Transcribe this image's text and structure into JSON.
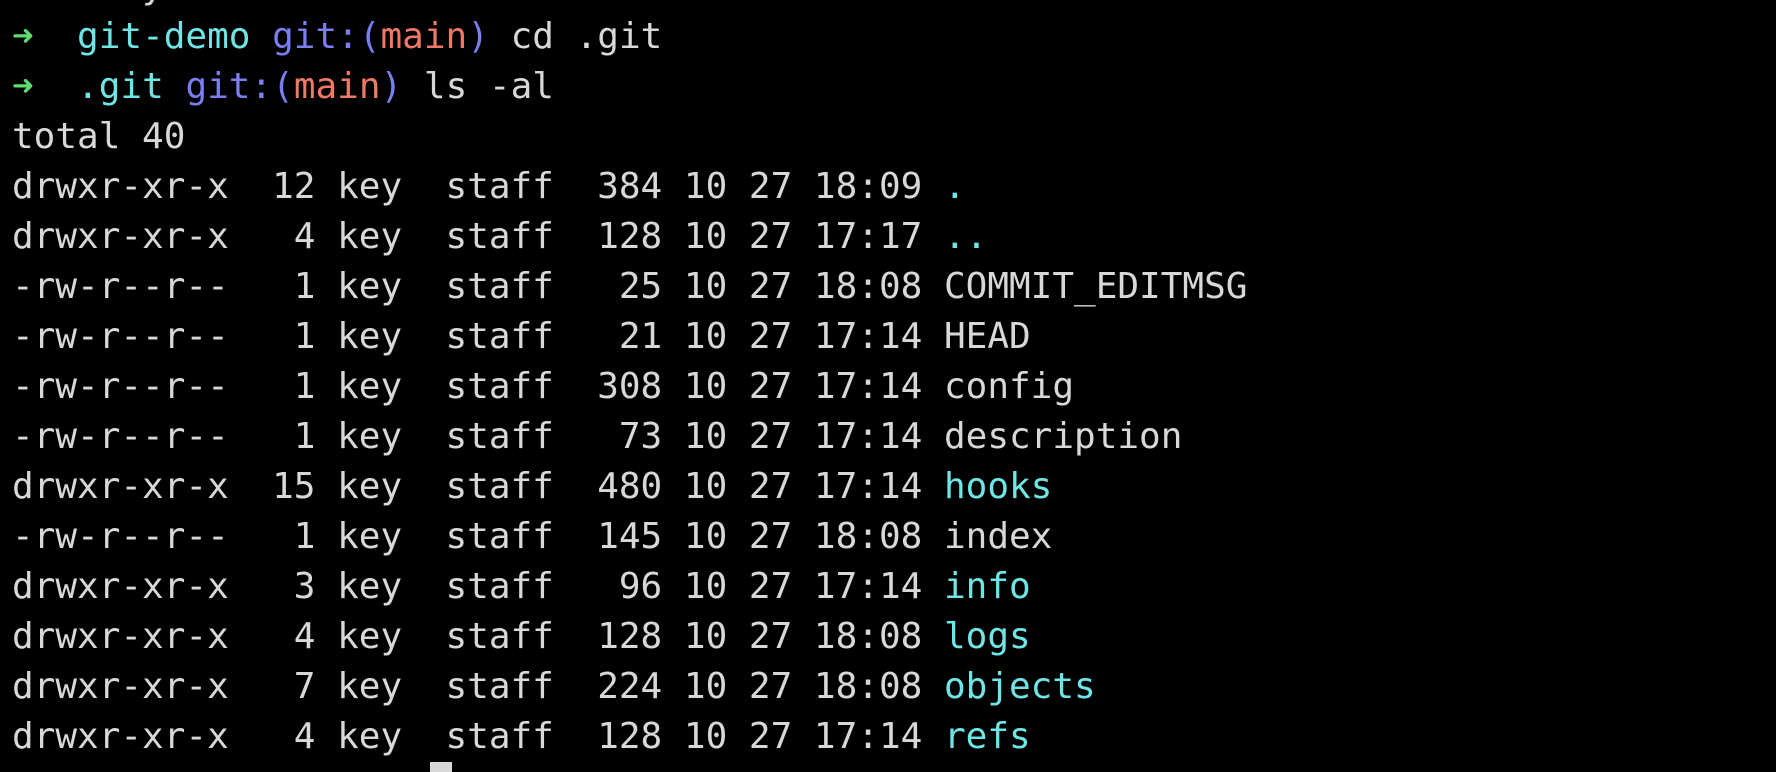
{
  "terminal": {
    "partial_top_line": "      y          r           r        r  r  r  ",
    "prompts": [
      {
        "arrow": "➜",
        "cwd": "git-demo",
        "git_prefix": "git:(",
        "branch": "main",
        "git_suffix": ")",
        "command": "cd .git"
      },
      {
        "arrow": "➜",
        "cwd": ".git",
        "git_prefix": "git:(",
        "branch": "main",
        "git_suffix": ")",
        "command": "ls -al"
      }
    ],
    "total_line": "total 40",
    "listing": [
      {
        "meta": "drwxr-xr-x  12 key  staff  384 10 27 18:09 ",
        "name": ".",
        "kind": "dir"
      },
      {
        "meta": "drwxr-xr-x   4 key  staff  128 10 27 17:17 ",
        "name": "..",
        "kind": "dir"
      },
      {
        "meta": "-rw-r--r--   1 key  staff   25 10 27 18:08 ",
        "name": "COMMIT_EDITMSG",
        "kind": "file"
      },
      {
        "meta": "-rw-r--r--   1 key  staff   21 10 27 17:14 ",
        "name": "HEAD",
        "kind": "file"
      },
      {
        "meta": "-rw-r--r--   1 key  staff  308 10 27 17:14 ",
        "name": "config",
        "kind": "file"
      },
      {
        "meta": "-rw-r--r--   1 key  staff   73 10 27 17:14 ",
        "name": "description",
        "kind": "file"
      },
      {
        "meta": "drwxr-xr-x  15 key  staff  480 10 27 17:14 ",
        "name": "hooks",
        "kind": "dir"
      },
      {
        "meta": "-rw-r--r--   1 key  staff  145 10 27 18:08 ",
        "name": "index",
        "kind": "file"
      },
      {
        "meta": "drwxr-xr-x   3 key  staff   96 10 27 17:14 ",
        "name": "info",
        "kind": "dir"
      },
      {
        "meta": "drwxr-xr-x   4 key  staff  128 10 27 18:08 ",
        "name": "logs",
        "kind": "dir"
      },
      {
        "meta": "drwxr-xr-x   7 key  staff  224 10 27 18:08 ",
        "name": "objects",
        "kind": "dir"
      },
      {
        "meta": "drwxr-xr-x   4 key  staff  128 10 27 17:14 ",
        "name": "refs",
        "kind": "dir"
      }
    ],
    "colors": {
      "background": "#000000",
      "text": "#d8d8d8",
      "arrow": "#5fdc6f",
      "cwd": "#6fe6e6",
      "git_label": "#7b7ef0",
      "branch": "#f07866",
      "directory": "#6fe6e6"
    }
  }
}
